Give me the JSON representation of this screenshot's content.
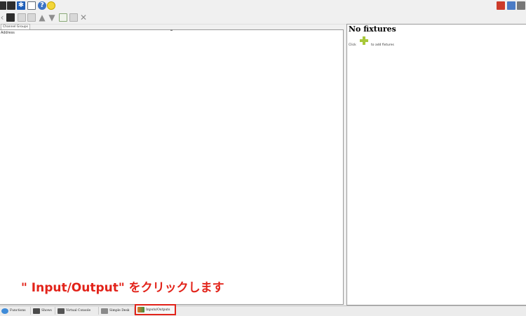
{
  "toolbar_top": {
    "right_icons": [
      "color-fixture-icon",
      "scene-icon",
      "print-icon"
    ]
  },
  "left_panel": {
    "tab_label": "Channel Groups",
    "column_header": "Address"
  },
  "right_panel": {
    "title": "No fixtures",
    "click_text": "Click",
    "add_text": "to add fixtures"
  },
  "annotation": {
    "text": "\" Input/Output\" をクリックします",
    "color": "#e2231a"
  },
  "bottom_tabs": [
    {
      "label": "Functions"
    },
    {
      "label": "Shows"
    },
    {
      "label": "Virtual Console"
    },
    {
      "label": "Simple Desk"
    },
    {
      "label": "Inputs/Outputs"
    }
  ]
}
